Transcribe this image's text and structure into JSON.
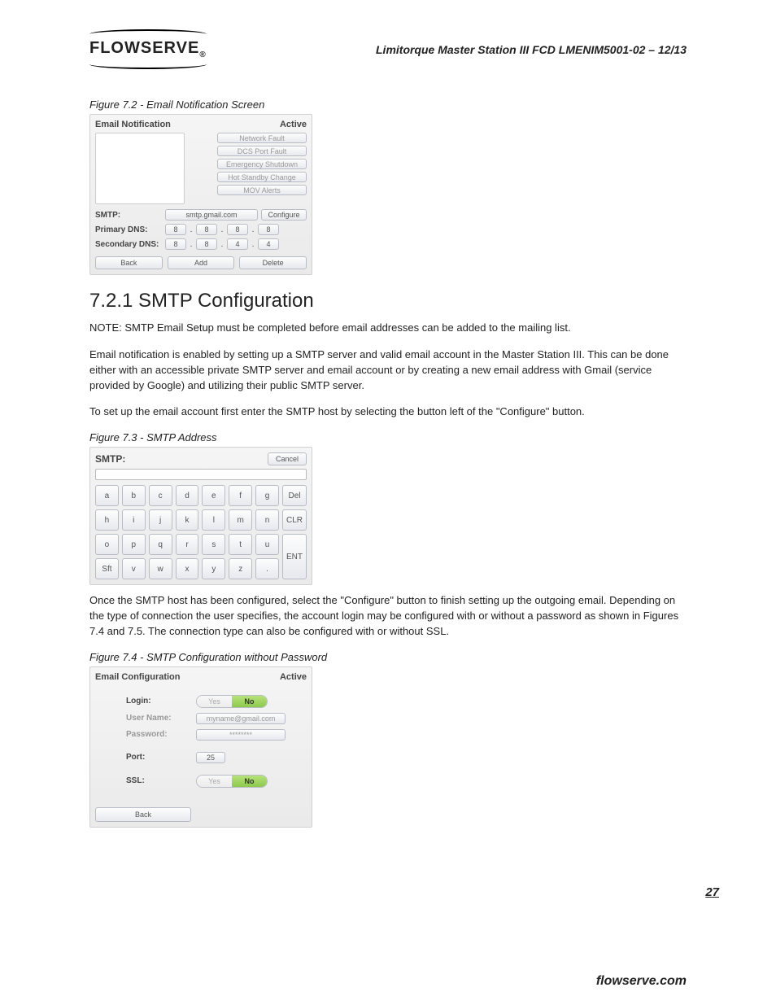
{
  "header": {
    "logo_text": "FLOWSERVE",
    "doc_title": "Limitorque Master Station III    FCD LMENIM5001-02 – 12/13"
  },
  "fig72": {
    "caption": "Figure 7.2 - Email Notification Screen",
    "panel_title": "Email Notification",
    "panel_status": "Active",
    "faults": [
      "Network Fault",
      "DCS Port Fault",
      "Emergency Shutdown",
      "Hot Standby Change",
      "MOV Alerts"
    ],
    "smtp_label": "SMTP:",
    "smtp_value": "smtp.gmail.com",
    "configure": "Configure",
    "pdns_label": "Primary DNS:",
    "pdns": [
      "8",
      "8",
      "8",
      "8"
    ],
    "sdns_label": "Secondary DNS:",
    "sdns": [
      "8",
      "8",
      "4",
      "4"
    ],
    "back": "Back",
    "add": "Add",
    "delete": "Delete"
  },
  "sec": {
    "heading": "7.2.1 SMTP Configuration",
    "note": "NOTE: SMTP Email Setup must be completed before email addresses can be added to the mailing list.",
    "p1": "Email notification is enabled by setting up a SMTP server and valid email account in the Master Station III. This can be done either with an accessible private SMTP server and email account or by creating a new email address with Gmail (service provided by Google) and utilizing their public SMTP server.",
    "p2": "To set up the email account first enter the SMTP host by selecting the button left of the \"Configure\" button."
  },
  "fig73": {
    "caption": "Figure 7.3 - SMTP Address",
    "smtp_label": "SMTP:",
    "cancel": "Cancel",
    "keys_r1": [
      "a",
      "b",
      "c",
      "d",
      "e",
      "f",
      "g",
      "Del"
    ],
    "keys_r2": [
      "h",
      "i",
      "j",
      "k",
      "l",
      "m",
      "n",
      "CLR"
    ],
    "keys_r3": [
      "o",
      "p",
      "q",
      "r",
      "s",
      "t",
      "u"
    ],
    "keys_r4": [
      "Sft",
      "v",
      "w",
      "x",
      "y",
      "z",
      "."
    ],
    "ent": "ENT"
  },
  "p3": "Once the SMTP host has been configured, select the \"Configure\" button to finish setting up the outgoing email. Depending on the type of connection the user specifies, the account login may be configured with or without a password as shown in Figures 7.4 and 7.5. The connection type can also be configured with or without SSL.",
  "fig74": {
    "caption": "Figure 7.4 - SMTP Configuration without Password",
    "panel_title": "Email Configuration",
    "panel_status": "Active",
    "login_label": "Login:",
    "yes": "Yes",
    "no": "No",
    "user_label": "User Name:",
    "user_value": "myname@gmail.com",
    "pass_label": "Password:",
    "pass_value": "********",
    "port_label": "Port:",
    "port_value": "25",
    "ssl_label": "SSL:",
    "back": "Back"
  },
  "footer": {
    "page": "27",
    "site": "flowserve.com"
  }
}
